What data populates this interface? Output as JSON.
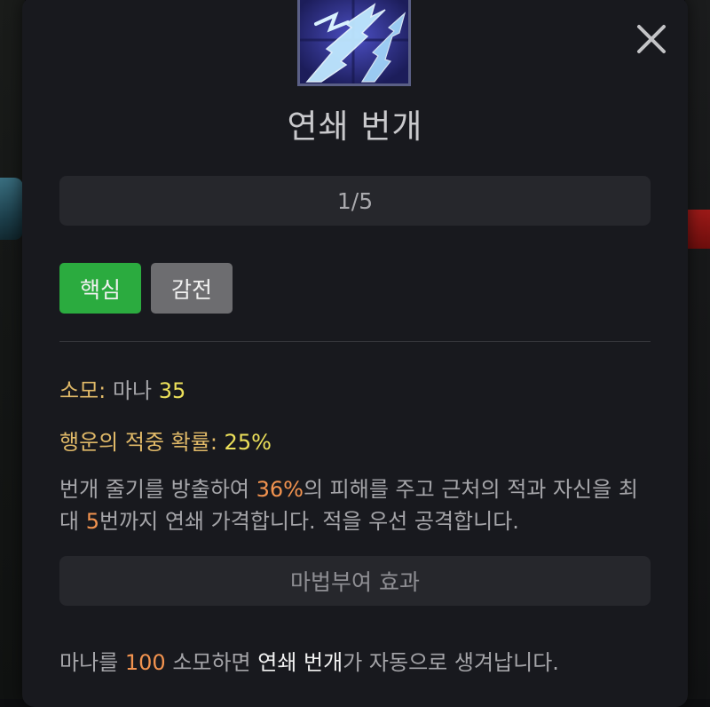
{
  "skill": {
    "name": "연쇄 번개",
    "level": "1/5",
    "tags": [
      "핵심",
      "감전"
    ]
  },
  "stats": {
    "cost_label": "소모:",
    "cost_text": "마나",
    "cost_value": "35",
    "luck_label": "행운의 적중 확률:",
    "luck_value": "25%"
  },
  "description": {
    "part1": "번개 줄기를 방출하여 ",
    "damage": "36%",
    "part2": "의 피해를 주고 근처의 적과 자신을 최대 ",
    "bounces": "5",
    "part3": "번까지 연쇄 가격합니다. 적을 우선 공격합니다."
  },
  "enchant": {
    "title": "마법부여 효과",
    "part1": "마나를 ",
    "mana": "100",
    "part2": " 소모하면 ",
    "skill_name": "연쇄 번개",
    "part3": "가 자동으로 생겨납니다."
  },
  "colors": {
    "accent_green": "#2bab3f",
    "tag_gray": "#6d6d70",
    "gold": "#e0b968",
    "yellow": "#ece05a",
    "orange": "#f2934f"
  },
  "icons": {
    "close": "close-icon",
    "skill": "chain-lightning-icon"
  }
}
